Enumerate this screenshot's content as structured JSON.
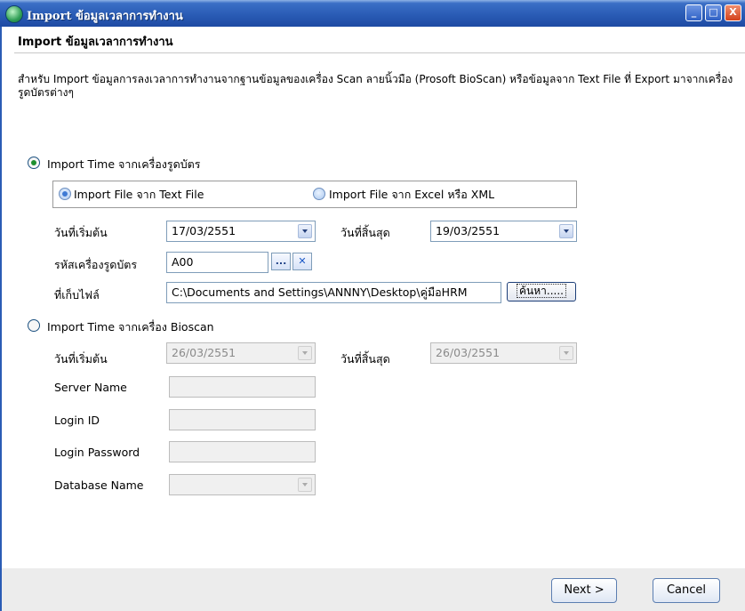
{
  "window": {
    "title": "Import ข้อมูลเวลาการทำงาน",
    "minimize": "_",
    "maximize": "□",
    "close": "X"
  },
  "header": {
    "title": "Import ข้อมูลเวลาการทำงาน",
    "description": "สำหรับ Import ข้อมูลการลงเวลาการทำงานจากฐานข้อมูลของเครื่อง Scan ลายนิ้วมือ (Prosoft BioScan) หรือข้อมูลจาก Text File ที่ Export มาจากเครื่องรูดบัตรต่างๆ"
  },
  "card_section": {
    "option_label": "Import Time จากเครื่องรูดบัตร",
    "selected": true,
    "file_type": {
      "text_file_label": "Import File จาก Text File",
      "excel_xml_label": "Import File จาก Excel หรือ XML",
      "selected": "text_file"
    },
    "start_date_label": "วันที่เริ่มต้น",
    "start_date_value": "17/03/2551",
    "end_date_label": "วันที่สิ้นสุด",
    "end_date_value": "19/03/2551",
    "machine_code_label": "รหัสเครื่องรูดบัตร",
    "machine_code_value": "A00",
    "lookup_button": "...",
    "clear_button": "✕",
    "file_location_label": "ที่เก็บไฟล์",
    "file_path_value": "C:\\Documents and Settings\\ANNNY\\Desktop\\คู่มือHRM",
    "browse_button": "ค้นหา....."
  },
  "bioscan_section": {
    "option_label": "Import Time จากเครื่อง Bioscan",
    "selected": false,
    "start_date_label": "วันที่เริ่มต้น",
    "start_date_value": "26/03/2551",
    "end_date_label": "วันที่สิ้นสุด",
    "end_date_value": "26/03/2551",
    "server_name_label": "Server Name",
    "server_name_value": "",
    "login_id_label": "Login ID",
    "login_id_value": "",
    "login_password_label": "Login Password",
    "login_password_value": "",
    "database_name_label": "Database Name",
    "database_name_value": ""
  },
  "footer": {
    "next_label": "Next >",
    "cancel_label": "Cancel"
  },
  "colors": {
    "titlebar": "#2a5cb5",
    "footer_bg": "#ececec",
    "selected_dot": "#1e8f2e"
  }
}
